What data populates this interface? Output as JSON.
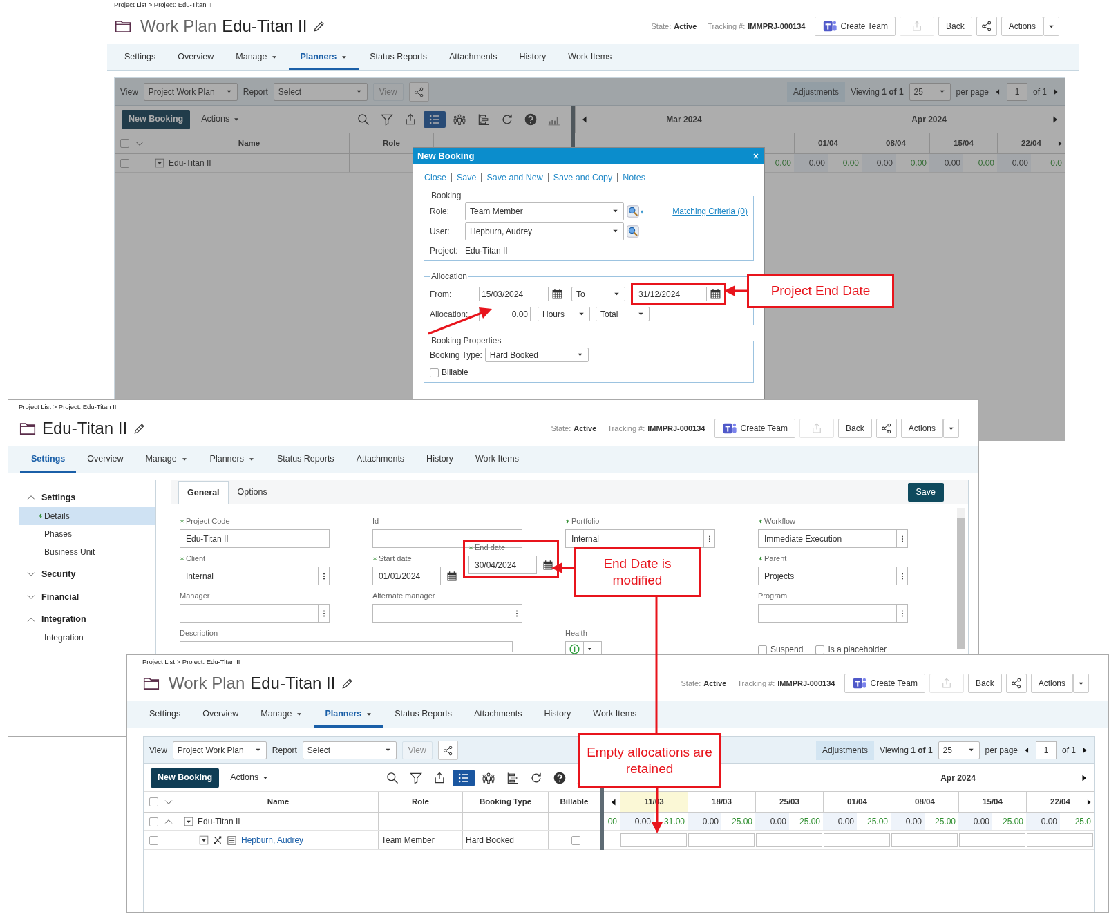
{
  "top_work_plan": {
    "breadcrumb": "Project List > Project: Edu-Titan II",
    "title_prefix": "Work Plan",
    "title": "Edu-Titan II",
    "state_label": "State:",
    "state": "Active",
    "tracking_label": "Tracking #:",
    "tracking": "IMMPRJ-000134",
    "create_team": "Create Team",
    "export_disabled": true,
    "back": "Back",
    "actions": "Actions",
    "tabs": [
      {
        "label": "Settings",
        "dropdown": false,
        "selected": false
      },
      {
        "label": "Overview",
        "dropdown": false,
        "selected": false
      },
      {
        "label": "Manage",
        "dropdown": true,
        "selected": false
      },
      {
        "label": "Planners",
        "dropdown": true,
        "selected": true
      },
      {
        "label": "Status Reports",
        "dropdown": false,
        "selected": false
      },
      {
        "label": "Attachments",
        "dropdown": false,
        "selected": false
      },
      {
        "label": "History",
        "dropdown": false,
        "selected": false
      },
      {
        "label": "Work Items",
        "dropdown": false,
        "selected": false
      }
    ],
    "toolbar": {
      "view_label": "View",
      "view_value": "Project Work Plan",
      "report_label": "Report",
      "report_value": "Select",
      "view_button": "View",
      "view_button_disabled": true,
      "adjustments": "Adjustments",
      "viewing": "Viewing **1 of 1**",
      "page_size": "25",
      "per_page": "per page",
      "page": "1",
      "of_pages": "of 1"
    },
    "new_booking": "New Booking",
    "actions_menu": "Actions",
    "view_modes": [
      {
        "selected": true
      },
      {
        "selected": false
      }
    ],
    "select_all_checked": false,
    "columns": [
      "Name",
      "Role"
    ],
    "rows": [
      {
        "name": "Edu-Titan II",
        "checked": false,
        "values": [
          {
            "text": "0.00",
            "kind": "available"
          },
          {
            "text": "0.00",
            "kind": "allocated"
          },
          {
            "text": "0.00",
            "kind": "available"
          },
          {
            "text": "0.00",
            "kind": "allocated"
          },
          {
            "text": "0.00",
            "kind": "available"
          },
          {
            "text": "0.00",
            "kind": "allocated"
          },
          {
            "text": "0.00",
            "kind": "available"
          },
          {
            "text": "0.00",
            "kind": "allocated"
          },
          {
            "text": "0.0",
            "kind": "available"
          }
        ]
      }
    ],
    "months": [
      "Mar 2024",
      "Apr 2024"
    ],
    "weeks": [
      {
        "label": "01/04",
        "highlighted": false
      },
      {
        "label": "08/04",
        "highlighted": false
      },
      {
        "label": "15/04",
        "highlighted": false
      },
      {
        "label": "22/04",
        "highlighted": false
      }
    ]
  },
  "new_booking_dialog": {
    "title": "New Booking",
    "links": [
      "Close",
      "Save",
      "Save and New",
      "Save and Copy",
      "Notes"
    ],
    "booking_legend": "Booking",
    "role_label": "Role:",
    "role": "Team Member",
    "role_required": true,
    "matching_criteria": "Matching Criteria (0)",
    "user_label": "User:",
    "user": "Hepburn, Audrey",
    "project_label": "Project:",
    "project": "Edu-Titan II",
    "allocation_legend": "Allocation",
    "from_label": "From:",
    "from": "15/03/2024",
    "to_mode": "To",
    "to": "31/12/2024",
    "to_highlighted": true,
    "allocation_label": "Allocation:",
    "allocation": "0.00",
    "unit": "Hours",
    "spread": "Total",
    "properties_legend": "Booking Properties",
    "booking_type_label": "Booking Type:",
    "booking_type": "Hard Booked",
    "billable_label": "Billable",
    "billable": false
  },
  "project_settings": {
    "breadcrumb": "Project List > Project: Edu-Titan II",
    "title": "Edu-Titan II",
    "state_label": "State:",
    "state": "Active",
    "tracking_label": "Tracking #:",
    "tracking": "IMMPRJ-000134",
    "create_team": "Create Team",
    "export_disabled": true,
    "back": "Back",
    "actions": "Actions",
    "tabs": [
      {
        "label": "Settings",
        "dropdown": false,
        "selected": true
      },
      {
        "label": "Overview",
        "dropdown": false,
        "selected": false
      },
      {
        "label": "Manage",
        "dropdown": true,
        "selected": false
      },
      {
        "label": "Planners",
        "dropdown": true,
        "selected": false
      },
      {
        "label": "Status Reports",
        "dropdown": false,
        "selected": false
      },
      {
        "label": "Attachments",
        "dropdown": false,
        "selected": false
      },
      {
        "label": "History",
        "dropdown": false,
        "selected": false
      },
      {
        "label": "Work Items",
        "dropdown": false,
        "selected": false
      }
    ],
    "sidebar": [
      {
        "label": "Settings",
        "expanded": true,
        "children": [
          {
            "label": "Details",
            "selected": true,
            "required": true
          },
          {
            "label": "Phases",
            "selected": false,
            "required": false
          },
          {
            "label": "Business Unit",
            "selected": false,
            "required": false
          }
        ]
      },
      {
        "label": "Security",
        "expanded": false
      },
      {
        "label": "Financial",
        "expanded": false
      },
      {
        "label": "Integration",
        "expanded": true,
        "children": [
          {
            "label": "Integration",
            "selected": false,
            "required": false
          }
        ]
      }
    ],
    "form_tabs": [
      {
        "label": "General",
        "selected": true
      },
      {
        "label": "Options",
        "selected": false
      }
    ],
    "save": "Save",
    "form_rows": [
      {
        "col_1": [
          {
            "label": "Project Code",
            "required": true,
            "value": "Edu-Titan II",
            "kind": "text"
          }
        ],
        "col_2": [
          {
            "label": "Id",
            "required": false,
            "kind": "text"
          }
        ],
        "col_3": [
          {
            "label": "Portfolio",
            "required": true,
            "value": "Internal",
            "kind": "picker"
          }
        ],
        "col_4": [
          {
            "label": "Workflow",
            "required": true,
            "value": "Immediate Execution",
            "kind": "picker"
          }
        ]
      },
      {
        "col_1": [
          {
            "label": "Client",
            "required": true,
            "value": "Internal",
            "kind": "picker"
          }
        ],
        "col_2": [
          {
            "label": "Start date",
            "required": true,
            "value": "01/01/2024",
            "kind": "date",
            "highlighted": false
          },
          {
            "label": "End date",
            "required": true,
            "value": "30/04/2024",
            "kind": "date",
            "highlighted": true
          }
        ],
        "col_4": [
          {
            "label": "Parent",
            "required": true,
            "value": "Projects",
            "kind": "picker"
          }
        ]
      },
      {
        "col_1": [
          {
            "label": "Manager",
            "required": false,
            "kind": "picker"
          }
        ],
        "col_2": [
          {
            "label": "Alternate manager",
            "required": false,
            "kind": "picker"
          }
        ],
        "col_4": [
          {
            "label": "Program",
            "required": false,
            "kind": "picker"
          }
        ]
      },
      {
        "col_1": [
          {
            "label": "Description",
            "required": false,
            "kind": "textarea"
          }
        ],
        "col_3": [
          {
            "label": "Health",
            "required": false,
            "kind": "health"
          }
        ],
        "col_4": [
          {
            "label": "Suspend",
            "checked": false,
            "kind": "checkbox"
          },
          {
            "label": "Is a placeholder",
            "checked": false,
            "kind": "checkbox"
          }
        ]
      }
    ]
  },
  "bottom_work_plan": {
    "breadcrumb": "Project List > Project: Edu-Titan II",
    "title_prefix": "Work Plan",
    "title": "Edu-Titan II",
    "state_label": "State:",
    "state": "Active",
    "tracking_label": "Tracking #:",
    "tracking": "IMMPRJ-000134",
    "create_team": "Create Team",
    "export_disabled": true,
    "back": "Back",
    "actions": "Actions",
    "tabs": [
      {
        "label": "Settings",
        "dropdown": false,
        "selected": false
      },
      {
        "label": "Overview",
        "dropdown": false,
        "selected": false
      },
      {
        "label": "Manage",
        "dropdown": true,
        "selected": false
      },
      {
        "label": "Planners",
        "dropdown": true,
        "selected": true
      },
      {
        "label": "Status Reports",
        "dropdown": false,
        "selected": false
      },
      {
        "label": "Attachments",
        "dropdown": false,
        "selected": false
      },
      {
        "label": "History",
        "dropdown": false,
        "selected": false
      },
      {
        "label": "Work Items",
        "dropdown": false,
        "selected": false
      }
    ],
    "toolbar": {
      "view_label": "View",
      "view_value": "Project Work Plan",
      "report_label": "Report",
      "report_value": "Select",
      "view_button": "View",
      "view_button_disabled": true,
      "adjustments": "Adjustments",
      "viewing": "Viewing **1 of 1**",
      "page_size": "25",
      "per_page": "per page",
      "page": "1",
      "of_pages": "of 1"
    },
    "new_booking": "New Booking",
    "actions_menu": "Actions",
    "view_modes": [
      {
        "selected": true
      },
      {
        "selected": false
      }
    ],
    "select_all_checked": false,
    "columns": [
      "Name",
      "Role",
      "Booking Type",
      "Billable"
    ],
    "rows": [
      {
        "name": "Edu-Titan II",
        "checked": false,
        "expanded": true,
        "values": [
          {
            "text": "00",
            "kind": "available"
          },
          {
            "text": "0.00",
            "kind": "allocated"
          },
          {
            "text": "31.00",
            "kind": "available"
          },
          {
            "text": "0.00",
            "kind": "allocated"
          },
          {
            "text": "25.00",
            "kind": "available"
          },
          {
            "text": "0.00",
            "kind": "allocated"
          },
          {
            "text": "25.00",
            "kind": "available"
          },
          {
            "text": "0.00",
            "kind": "allocated"
          },
          {
            "text": "25.00",
            "kind": "available"
          },
          {
            "text": "0.00",
            "kind": "allocated"
          },
          {
            "text": "25.00",
            "kind": "available"
          },
          {
            "text": "0.00",
            "kind": "allocated"
          },
          {
            "text": "25.00",
            "kind": "available"
          },
          {
            "text": "0.00",
            "kind": "allocated"
          },
          {
            "text": "25.0",
            "kind": "available"
          }
        ],
        "children": [
          {
            "name": "Hepburn, Audrey",
            "checked": false,
            "role": "Team Member",
            "booking_type": "Hard Booked",
            "billable": false
          }
        ]
      }
    ],
    "months": [
      "Apr 2024"
    ],
    "weeks": [
      {
        "label": "11/03",
        "highlighted": true
      },
      {
        "label": "18/03",
        "highlighted": false
      },
      {
        "label": "25/03",
        "highlighted": false
      },
      {
        "label": "01/04",
        "highlighted": false
      },
      {
        "label": "08/04",
        "highlighted": false
      },
      {
        "label": "15/04",
        "highlighted": false
      },
      {
        "label": "22/04",
        "highlighted": false
      }
    ]
  },
  "callouts": [
    {
      "text": "Project End Date"
    },
    {
      "text": "End Date is modified"
    },
    {
      "text": "Empty allocations are retained"
    }
  ]
}
